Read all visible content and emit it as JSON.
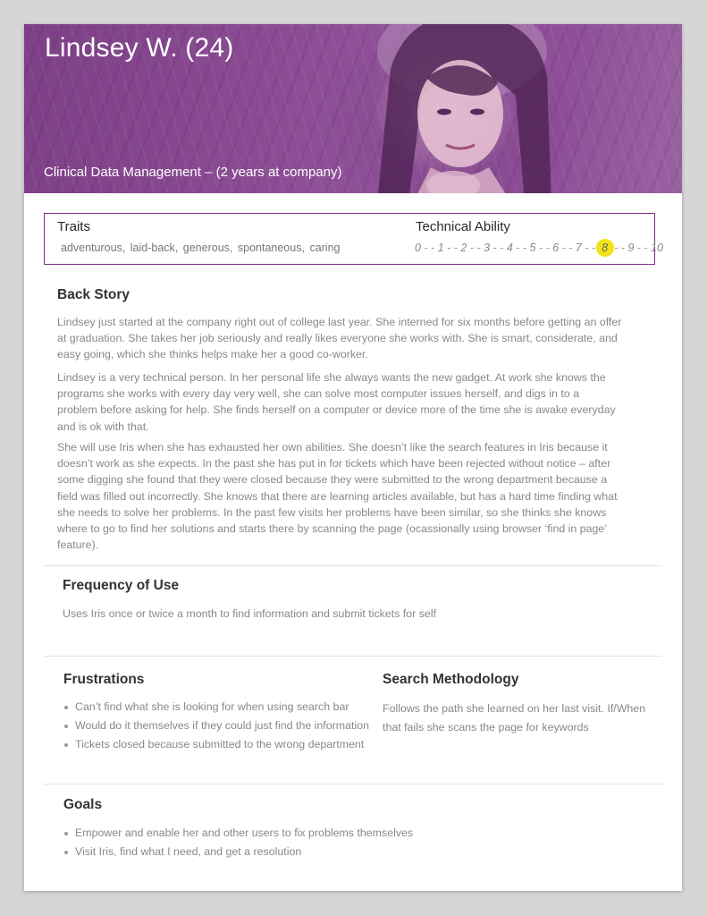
{
  "header": {
    "name": "Lindsey W. (24)",
    "role": "Clinical Data Management – (2 years at company)",
    "overlay_color": "#8a4b93"
  },
  "traits": {
    "heading": "Traits",
    "items": [
      "adventurous",
      "laid-back",
      "generous",
      "spontaneous",
      "caring"
    ]
  },
  "technical_ability": {
    "heading": "Technical Ability",
    "scale": [
      "0",
      "1",
      "2",
      "3",
      "4",
      "5",
      "6",
      "7",
      "8",
      "9",
      "10"
    ],
    "selected": "8",
    "highlight_color": "#f2e21b"
  },
  "back_story": {
    "title": "Back Story",
    "p1": "Lindsey just started at the company right out of college last year. She interned for six months before getting an offer at graduation. She takes her job seriously and really likes everyone she works with. She is smart, considerate, and easy going, which she thinks helps make her a good co-worker.",
    "p2": "Lindsey is a very technical person. In her personal life she always wants the new gadget. At work she knows the programs she works with every day very well, she can solve most computer issues herself, and digs in to a problem before asking for help. She finds herself on a computer or device more of the time she is awake everyday and is ok with that.",
    "p3": "She will use Iris when she has exhausted her own abilities. She doesn’t like the search features in Iris because it doesn’t work as she expects. In the past she has put in for tickets which have been rejected without notice – after some digging she found that they were closed because they were submitted to the wrong department because a field was filled out incorrectly. She knows that there are learning articles available, but has a hard time finding what she needs to solve her problems. In the past few visits her problems have been similar, so she thinks she knows where to go to find her solutions and starts there by scanning the page (ocassionally using browser ‘find in page’ feature)."
  },
  "frequency": {
    "title": "Frequency of Use",
    "text": "Uses Iris once or twice a month to find information and submit tickets for self"
  },
  "frustrations": {
    "title": "Frustrations",
    "items": [
      "Can’t find what she is looking for when using search bar",
      "Would do it themselves if they could just find the information",
      "Tickets closed because submitted to the wrong department"
    ]
  },
  "search_methodology": {
    "title": "Search Methodology",
    "text": "Follows the path she learned on her last visit. If/When that fails she scans the page for keywords"
  },
  "goals": {
    "title": "Goals",
    "items": [
      "Empower and enable her and other users to fix problems themselves",
      "Visit Iris, find what I need, and get a resolution"
    ]
  }
}
